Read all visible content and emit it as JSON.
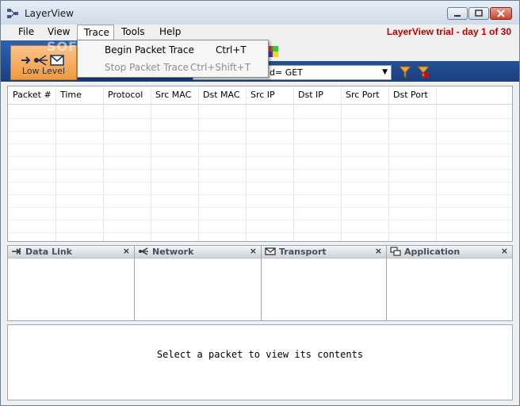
{
  "window": {
    "title": "LayerView"
  },
  "menu": {
    "items": [
      "File",
      "View",
      "Trace",
      "Tools",
      "Help"
    ],
    "trial_text": "LayerView trial - day 1 of 30"
  },
  "trace_menu": [
    {
      "label": "Begin Packet Trace",
      "shortcut": "Ctrl+T",
      "enabled": true
    },
    {
      "label": "Stop Packet Trace",
      "shortcut": "Ctrl+Shift+T",
      "enabled": false
    }
  ],
  "toolbar": {
    "low_level_label": "Low Level",
    "filter_value": "d= GET"
  },
  "watermark": "SOFTPE",
  "grid": {
    "columns": [
      "Packet #",
      "Time",
      "Protocol",
      "Src MAC",
      "Dst MAC",
      "Src IP",
      "Dst IP",
      "Src Port",
      "Dst Port"
    ]
  },
  "panes": [
    {
      "title": "Data Link",
      "icon": "data-link-icon",
      "close": "×"
    },
    {
      "title": "Network",
      "icon": "network-icon",
      "close": "×"
    },
    {
      "title": "Transport",
      "icon": "transport-icon",
      "close": "×"
    },
    {
      "title": "Application",
      "icon": "application-icon",
      "close": "×"
    }
  ],
  "packet_view": {
    "message": "Select a packet to view its contents"
  },
  "colors": {
    "accent": "#1a3f7d",
    "trial": "#c00000",
    "low_level": "#f09a3e"
  }
}
